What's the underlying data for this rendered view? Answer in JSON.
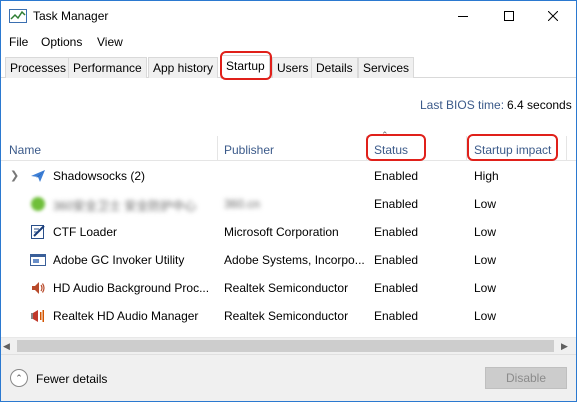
{
  "window": {
    "title": "Task Manager",
    "icons": {
      "app": "task-manager-icon",
      "minimize": "minimize-icon",
      "maximize": "maximize-icon",
      "close": "close-icon"
    }
  },
  "menu": [
    "File",
    "Options",
    "View"
  ],
  "tabs": [
    "Processes",
    "Performance",
    "App history",
    "Startup",
    "Users",
    "Details",
    "Services"
  ],
  "active_tab": "Startup",
  "bios": {
    "label": "Last BIOS time:",
    "value": "6.4 seconds"
  },
  "columns": {
    "name": "Name",
    "publisher": "Publisher",
    "status": "Status",
    "impact": "Startup impact"
  },
  "rows": [
    {
      "name": "Shadowsocks (2)",
      "publisher": "",
      "status": "Enabled",
      "impact": "High",
      "icon": "paper-plane-icon",
      "expandable": true
    },
    {
      "name": "360安全卫士 安全防护中心",
      "publisher": "360.cn",
      "status": "Enabled",
      "impact": "Low",
      "icon": "shield-app-icon",
      "blurred": true
    },
    {
      "name": "CTF Loader",
      "publisher": "Microsoft Corporation",
      "status": "Enabled",
      "impact": "Low",
      "icon": "ctf-loader-icon"
    },
    {
      "name": "Adobe GC Invoker Utility",
      "publisher": "Adobe Systems, Incorpo...",
      "status": "Enabled",
      "impact": "Low",
      "icon": "adobe-app-icon"
    },
    {
      "name": "HD Audio Background Proc...",
      "publisher": "Realtek Semiconductor",
      "status": "Enabled",
      "impact": "Low",
      "icon": "speaker-icon"
    },
    {
      "name": "Realtek HD Audio Manager",
      "publisher": "Realtek Semiconductor",
      "status": "Enabled",
      "impact": "Low",
      "icon": "audio-manager-icon"
    }
  ],
  "footer": {
    "fewer_details": "Fewer details",
    "disable": "Disable"
  },
  "colors": {
    "accent_border": "#2b79d0",
    "highlight": "#e0201a",
    "header_text": "#3b5a8a"
  }
}
